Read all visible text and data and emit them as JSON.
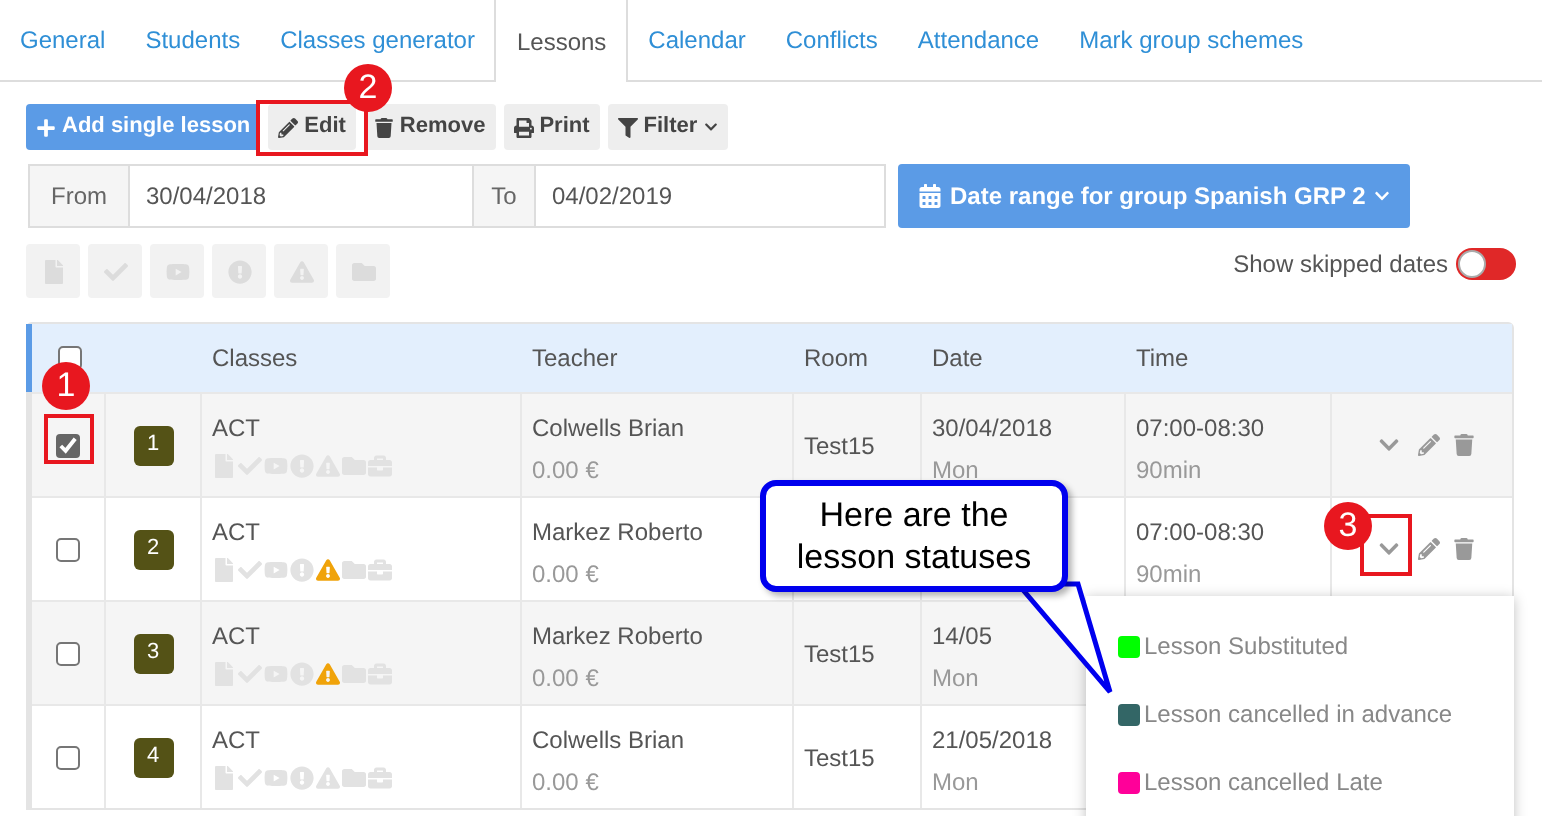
{
  "tabs": [
    {
      "label": "General",
      "selected": false
    },
    {
      "label": "Students",
      "selected": false
    },
    {
      "label": "Classes generator",
      "selected": false
    },
    {
      "label": "Lessons",
      "selected": true
    },
    {
      "label": "Calendar",
      "selected": false
    },
    {
      "label": "Conflicts",
      "selected": false
    },
    {
      "label": "Attendance",
      "selected": false
    },
    {
      "label": "Mark group schemes",
      "selected": false
    }
  ],
  "toolbar": [
    {
      "label": "Add single lesson",
      "kind": "primary"
    },
    {
      "label": "Edit",
      "kind": "default"
    },
    {
      "label": "Remove",
      "kind": "default"
    },
    {
      "label": "Print",
      "kind": "default"
    },
    {
      "label": "Filter",
      "kind": "dropdown"
    }
  ],
  "date_range": {
    "from_label": "From",
    "from_value": "30/04/2018",
    "to_label": "To",
    "to_value": "04/02/2019",
    "group_button": "Date range for group Spanish GRP 2"
  },
  "show_skipped_dates": {
    "label": "Show skipped dates",
    "on": false
  },
  "table": {
    "header_checked": false,
    "columns": [
      "Classes",
      "Teacher",
      "Room",
      "Date",
      "Time"
    ],
    "rows": [
      {
        "selected": true,
        "number": "1",
        "class": "ACT",
        "warning": false,
        "teacher": "Colwells Brian",
        "price": "0.00 €",
        "room": "Test15",
        "date": "30/04/2018",
        "day": "Mon",
        "time": "07:00-08:30",
        "duration": "90min"
      },
      {
        "selected": false,
        "number": "2",
        "class": "ACT",
        "warning": true,
        "teacher": "Markez Roberto",
        "price": "0.00 €",
        "time": "07:00-08:30",
        "duration": "90min",
        "status_menu": [
          {
            "label": "Lesson Substituted",
            "color": "#00ff00"
          },
          {
            "label": "Lesson cancelled in advance",
            "color": "#336666"
          },
          {
            "label": "Lesson cancelled Late",
            "color": "#ff0099"
          }
        ]
      },
      {
        "selected": false,
        "number": "3",
        "class": "ACT",
        "warning": true,
        "teacher": "Markez Roberto",
        "price": "0.00 €",
        "room": "Test15",
        "date": "14/05",
        "day": "Mon"
      },
      {
        "selected": false,
        "number": "4",
        "class": "ACT",
        "warning": false,
        "teacher": "Colwells Brian",
        "price": "0.00 €",
        "room": "Test15",
        "date": "21/05/2018",
        "day": "Mon"
      }
    ]
  },
  "callout": "Here are the lesson statuses",
  "annotations": [
    {
      "number": "1"
    },
    {
      "number": "2"
    },
    {
      "number": "3"
    }
  ]
}
